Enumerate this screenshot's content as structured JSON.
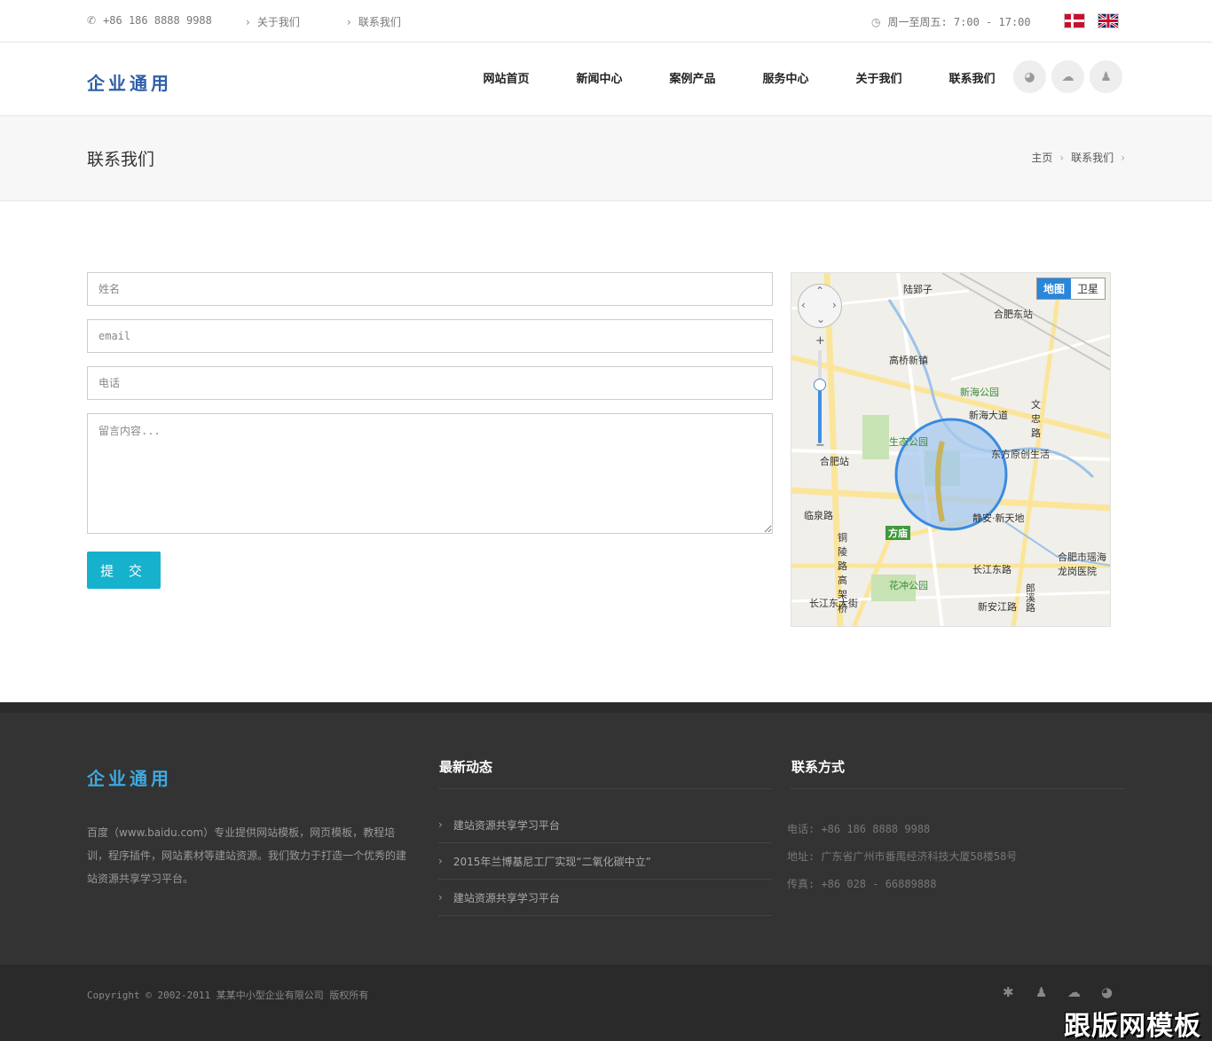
{
  "topbar": {
    "phone": "+86 186 8888 9988",
    "link_about": "关于我们",
    "link_contact": "联系我们",
    "hours": "周一至周五: 7:00 - 17:00"
  },
  "header": {
    "logo": "企业通用",
    "nav": [
      "网站首页",
      "新闻中心",
      "案例产品",
      "服务中心",
      "关于我们",
      "联系我们"
    ]
  },
  "page": {
    "title": "联系我们",
    "breadcrumb": [
      "主页",
      "联系我们"
    ]
  },
  "form": {
    "name_placeholder": "姓名",
    "email_placeholder": "email",
    "phone_placeholder": "电话",
    "message_placeholder": "留言内容...",
    "submit_label": "提 交"
  },
  "map": {
    "type_map": "地图",
    "type_satellite": "卫星",
    "labels": [
      "陆郢子",
      "合肥东站",
      "高桥新镇",
      "新海公园",
      "新海大道",
      "文忠路",
      "生态公园",
      "合肥站",
      "东方原创生活",
      "临泉路",
      "方庙",
      "静安·新天地",
      "合肥市瑶海龙岗医院",
      "长江东路",
      "花冲公园",
      "长江东大街",
      "新安江路",
      "铜陵路高架桥",
      "郎溪路"
    ]
  },
  "footer": {
    "logo": "企业通用",
    "about": "百度（www.baidu.com）专业提供网站模板，网页模板，教程培训，程序插件，网站素材等建站资源。我们致力于打造一个优秀的建站资源共享学习平台。",
    "news_title": "最新动态",
    "news": [
      "建站资源共享学习平台",
      "2015年兰博基尼工厂实现“二氧化碳中立”",
      "建站资源共享学习平台"
    ],
    "contact_title": "联系方式",
    "contact": {
      "phone": "电话: +86 186 8888 9988",
      "address": "地址: 广东省广州市番禺经济科技大厦58楼58号",
      "fax": "传真: +86 028 - 66889888"
    }
  },
  "bottom": {
    "copyright": "Copyright © 2002-2011 某某中小型企业有限公司 版权所有",
    "watermark": "跟版网模板"
  }
}
